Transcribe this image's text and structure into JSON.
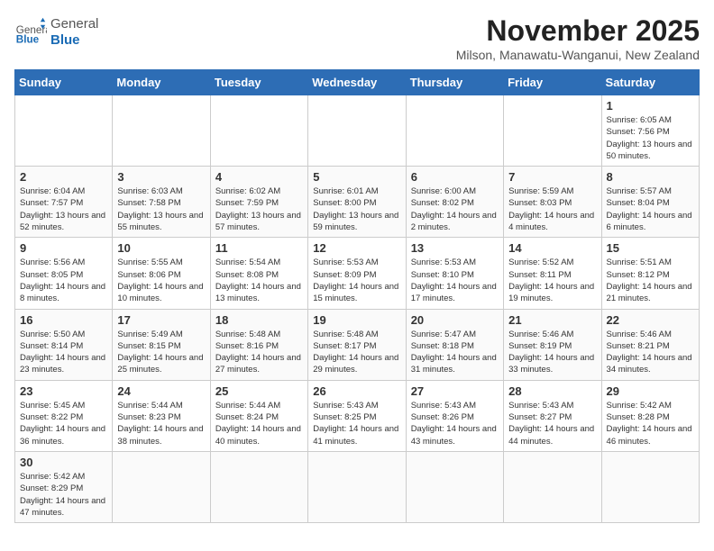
{
  "header": {
    "logo_line1": "General",
    "logo_line2": "Blue",
    "title": "November 2025",
    "location": "Milson, Manawatu-Wanganui, New Zealand"
  },
  "weekdays": [
    "Sunday",
    "Monday",
    "Tuesday",
    "Wednesday",
    "Thursday",
    "Friday",
    "Saturday"
  ],
  "weeks": [
    [
      {
        "day": "",
        "info": ""
      },
      {
        "day": "",
        "info": ""
      },
      {
        "day": "",
        "info": ""
      },
      {
        "day": "",
        "info": ""
      },
      {
        "day": "",
        "info": ""
      },
      {
        "day": "",
        "info": ""
      },
      {
        "day": "1",
        "info": "Sunrise: 6:05 AM\nSunset: 7:56 PM\nDaylight: 13 hours\nand 50 minutes."
      }
    ],
    [
      {
        "day": "2",
        "info": "Sunrise: 6:04 AM\nSunset: 7:57 PM\nDaylight: 13 hours\nand 52 minutes."
      },
      {
        "day": "3",
        "info": "Sunrise: 6:03 AM\nSunset: 7:58 PM\nDaylight: 13 hours\nand 55 minutes."
      },
      {
        "day": "4",
        "info": "Sunrise: 6:02 AM\nSunset: 7:59 PM\nDaylight: 13 hours\nand 57 minutes."
      },
      {
        "day": "5",
        "info": "Sunrise: 6:01 AM\nSunset: 8:00 PM\nDaylight: 13 hours\nand 59 minutes."
      },
      {
        "day": "6",
        "info": "Sunrise: 6:00 AM\nSunset: 8:02 PM\nDaylight: 14 hours\nand 2 minutes."
      },
      {
        "day": "7",
        "info": "Sunrise: 5:59 AM\nSunset: 8:03 PM\nDaylight: 14 hours\nand 4 minutes."
      },
      {
        "day": "8",
        "info": "Sunrise: 5:57 AM\nSunset: 8:04 PM\nDaylight: 14 hours\nand 6 minutes."
      }
    ],
    [
      {
        "day": "9",
        "info": "Sunrise: 5:56 AM\nSunset: 8:05 PM\nDaylight: 14 hours\nand 8 minutes."
      },
      {
        "day": "10",
        "info": "Sunrise: 5:55 AM\nSunset: 8:06 PM\nDaylight: 14 hours\nand 10 minutes."
      },
      {
        "day": "11",
        "info": "Sunrise: 5:54 AM\nSunset: 8:08 PM\nDaylight: 14 hours\nand 13 minutes."
      },
      {
        "day": "12",
        "info": "Sunrise: 5:53 AM\nSunset: 8:09 PM\nDaylight: 14 hours\nand 15 minutes."
      },
      {
        "day": "13",
        "info": "Sunrise: 5:53 AM\nSunset: 8:10 PM\nDaylight: 14 hours\nand 17 minutes."
      },
      {
        "day": "14",
        "info": "Sunrise: 5:52 AM\nSunset: 8:11 PM\nDaylight: 14 hours\nand 19 minutes."
      },
      {
        "day": "15",
        "info": "Sunrise: 5:51 AM\nSunset: 8:12 PM\nDaylight: 14 hours\nand 21 minutes."
      }
    ],
    [
      {
        "day": "16",
        "info": "Sunrise: 5:50 AM\nSunset: 8:14 PM\nDaylight: 14 hours\nand 23 minutes."
      },
      {
        "day": "17",
        "info": "Sunrise: 5:49 AM\nSunset: 8:15 PM\nDaylight: 14 hours\nand 25 minutes."
      },
      {
        "day": "18",
        "info": "Sunrise: 5:48 AM\nSunset: 8:16 PM\nDaylight: 14 hours\nand 27 minutes."
      },
      {
        "day": "19",
        "info": "Sunrise: 5:48 AM\nSunset: 8:17 PM\nDaylight: 14 hours\nand 29 minutes."
      },
      {
        "day": "20",
        "info": "Sunrise: 5:47 AM\nSunset: 8:18 PM\nDaylight: 14 hours\nand 31 minutes."
      },
      {
        "day": "21",
        "info": "Sunrise: 5:46 AM\nSunset: 8:19 PM\nDaylight: 14 hours\nand 33 minutes."
      },
      {
        "day": "22",
        "info": "Sunrise: 5:46 AM\nSunset: 8:21 PM\nDaylight: 14 hours\nand 34 minutes."
      }
    ],
    [
      {
        "day": "23",
        "info": "Sunrise: 5:45 AM\nSunset: 8:22 PM\nDaylight: 14 hours\nand 36 minutes."
      },
      {
        "day": "24",
        "info": "Sunrise: 5:44 AM\nSunset: 8:23 PM\nDaylight: 14 hours\nand 38 minutes."
      },
      {
        "day": "25",
        "info": "Sunrise: 5:44 AM\nSunset: 8:24 PM\nDaylight: 14 hours\nand 40 minutes."
      },
      {
        "day": "26",
        "info": "Sunrise: 5:43 AM\nSunset: 8:25 PM\nDaylight: 14 hours\nand 41 minutes."
      },
      {
        "day": "27",
        "info": "Sunrise: 5:43 AM\nSunset: 8:26 PM\nDaylight: 14 hours\nand 43 minutes."
      },
      {
        "day": "28",
        "info": "Sunrise: 5:43 AM\nSunset: 8:27 PM\nDaylight: 14 hours\nand 44 minutes."
      },
      {
        "day": "29",
        "info": "Sunrise: 5:42 AM\nSunset: 8:28 PM\nDaylight: 14 hours\nand 46 minutes."
      }
    ],
    [
      {
        "day": "30",
        "info": "Sunrise: 5:42 AM\nSunset: 8:29 PM\nDaylight: 14 hours\nand 47 minutes."
      },
      {
        "day": "",
        "info": ""
      },
      {
        "day": "",
        "info": ""
      },
      {
        "day": "",
        "info": ""
      },
      {
        "day": "",
        "info": ""
      },
      {
        "day": "",
        "info": ""
      },
      {
        "day": "",
        "info": ""
      }
    ]
  ]
}
